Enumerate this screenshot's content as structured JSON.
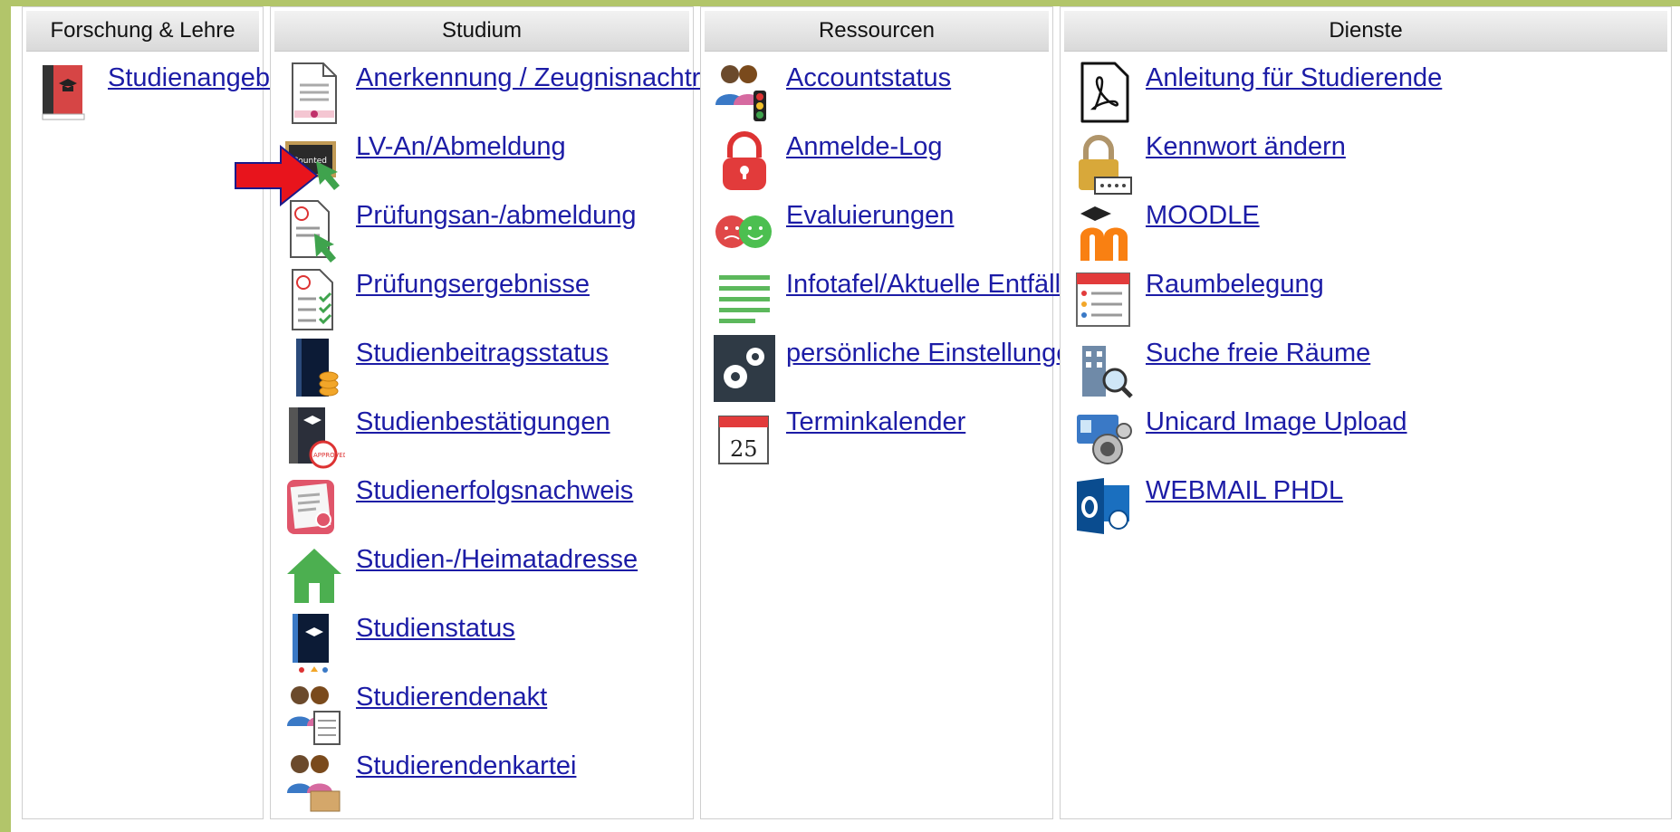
{
  "columns": [
    {
      "header": "Forschung & Lehre",
      "items": [
        {
          "label": "Studienangebot",
          "icon": "red-book-icon"
        }
      ]
    },
    {
      "header": "Studium",
      "items": [
        {
          "label": "Anerkennung / Zeugnisnachtrag",
          "icon": "certificate-document-icon"
        },
        {
          "label": "LV-An/Abmeldung",
          "icon": "blackboard-cursor-icon"
        },
        {
          "label": "Prüfungsan-/abmeldung",
          "icon": "exam-document-cursor-icon"
        },
        {
          "label": "Prüfungsergebnisse",
          "icon": "exam-results-icon"
        },
        {
          "label": "Studienbeitragsstatus",
          "icon": "book-coins-icon"
        },
        {
          "label": "Studienbestätigungen",
          "icon": "book-approved-stamp-icon"
        },
        {
          "label": "Studienerfolgsnachweis",
          "icon": "certificate-seal-icon"
        },
        {
          "label": "Studien-/Heimatadresse",
          "icon": "green-house-icon"
        },
        {
          "label": "Studienstatus",
          "icon": "study-status-book-icon"
        },
        {
          "label": "Studierendenakt",
          "icon": "students-file-icon"
        },
        {
          "label": "Studierendenkartei",
          "icon": "students-cardbox-icon"
        }
      ]
    },
    {
      "header": "Ressourcen",
      "items": [
        {
          "label": "Accountstatus",
          "icon": "users-traffic-light-icon"
        },
        {
          "label": "Anmelde-Log",
          "icon": "red-padlock-icon"
        },
        {
          "label": "Evaluierungen",
          "icon": "smiley-faces-icon"
        },
        {
          "label": "Infotafel/Aktuelle Entfälle",
          "icon": "info-board-lines-icon"
        },
        {
          "label": "persönliche Einstellungen",
          "icon": "gears-icon"
        },
        {
          "label": "Terminkalender",
          "icon": "calendar-icon"
        }
      ]
    },
    {
      "header": "Dienste",
      "items": [
        {
          "label": "Anleitung für Studierende",
          "icon": "pdf-document-icon"
        },
        {
          "label": "Kennwort ändern",
          "icon": "padlock-password-icon"
        },
        {
          "label": "MOODLE",
          "icon": "moodle-logo-icon"
        },
        {
          "label": "Raumbelegung",
          "icon": "room-schedule-icon"
        },
        {
          "label": "Suche freie Räume",
          "icon": "building-search-icon"
        },
        {
          "label": "Unicard Image Upload",
          "icon": "id-card-camera-icon"
        },
        {
          "label": "WEBMAIL PHDL",
          "icon": "outlook-mail-icon"
        }
      ]
    }
  ],
  "annotation": {
    "icon": "red-arrow-icon",
    "points_to": "LV-An/Abmeldung",
    "color": "#e8141c"
  },
  "colors": {
    "link": "#1c1ca6",
    "frame": "#b2c56a"
  }
}
